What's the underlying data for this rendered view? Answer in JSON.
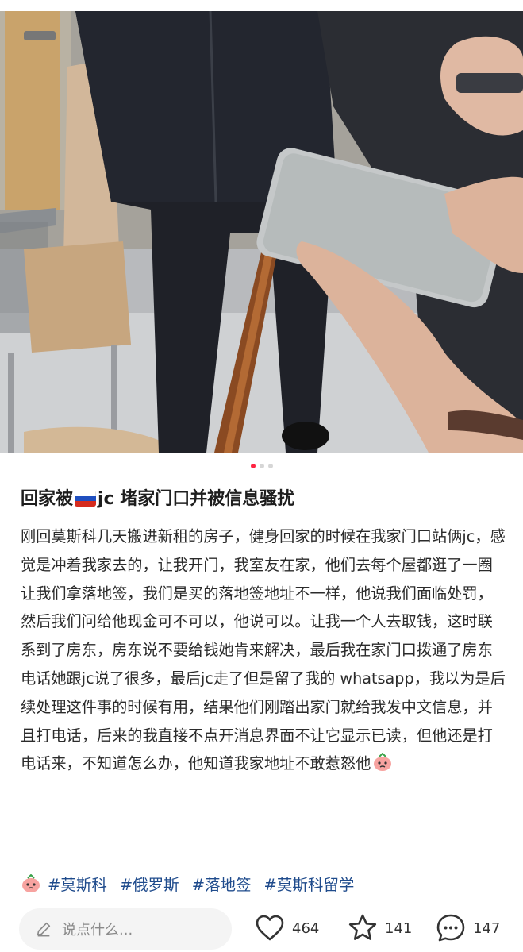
{
  "post": {
    "title_prefix": "回家被",
    "title_suffix": "jc 堵家门口并被信息骚扰",
    "body": "刚回莫斯科几天搬进新租的房子，健身回家的时候在我家门口站俩jc，感觉是冲着我家去的，让我开门，我室友在家，他们去每个屋都逛了一圈让我们拿落地签，我们是买的落地签地址不一样，他说我们面临处罚，然后我们问给他现金可不可以，他说可以。让我一个人去取钱，这时联系到了房东，房东说不要给钱她肯来解决，最后我在家门口拨通了房东电话她跟jc说了很多，最后jc走了但是留了我的 whatsapp，我以为是后续处理这件事的时候有用，结果他们刚踏出家门就给我发中文信息，并且打电话，后来的我直接不点开消息界面不让它显示已读，但他还是打电话来，不知道怎么办，他知道我家地址不敢惹怒他",
    "tags": [
      "#莫斯科",
      "#俄罗斯",
      "#落地签",
      "#莫斯科留学"
    ]
  },
  "carousel": {
    "count": 3,
    "active": 0
  },
  "bottom_bar": {
    "comment_placeholder": "说点什么...",
    "likes": "464",
    "favorites": "141",
    "comments": "147"
  },
  "colors": {
    "accent": "#ff2442",
    "tag": "#1f4b8c"
  }
}
